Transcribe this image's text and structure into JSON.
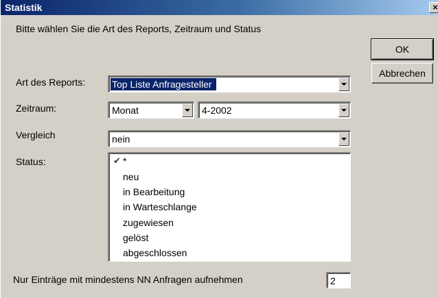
{
  "window": {
    "title": "Statistik",
    "close_glyph": "×"
  },
  "instruction": "Bitte wählen Sie die Art des Reports, Zeitraum und Status",
  "buttons": {
    "ok": "OK",
    "cancel": "Abbrechen"
  },
  "report_type": {
    "label": "Art des Reports:",
    "value": "Top Liste Anfragesteller"
  },
  "period": {
    "label": "Zeitraum:",
    "unit_value": "Monat",
    "date_value": "4-2002"
  },
  "comparison": {
    "label": "Vergleich",
    "value": "nein"
  },
  "status": {
    "label": "Status:",
    "check_glyph": "✔",
    "items": [
      {
        "text": "*",
        "checked": true
      },
      {
        "text": "neu",
        "checked": false
      },
      {
        "text": "in Bearbeitung",
        "checked": false
      },
      {
        "text": "in Warteschlange",
        "checked": false
      },
      {
        "text": "zugewiesen",
        "checked": false
      },
      {
        "text": "gelöst",
        "checked": false
      },
      {
        "text": "abgeschlossen",
        "checked": false
      }
    ]
  },
  "min_entries": {
    "label": "Nur Einträge mit mindestens NN Anfragen aufnehmen",
    "value": "2"
  },
  "colors": {
    "face": "#d4d0c8",
    "title_start": "#0a246a",
    "title_end": "#a6caf0",
    "selection": "#0a246a"
  }
}
